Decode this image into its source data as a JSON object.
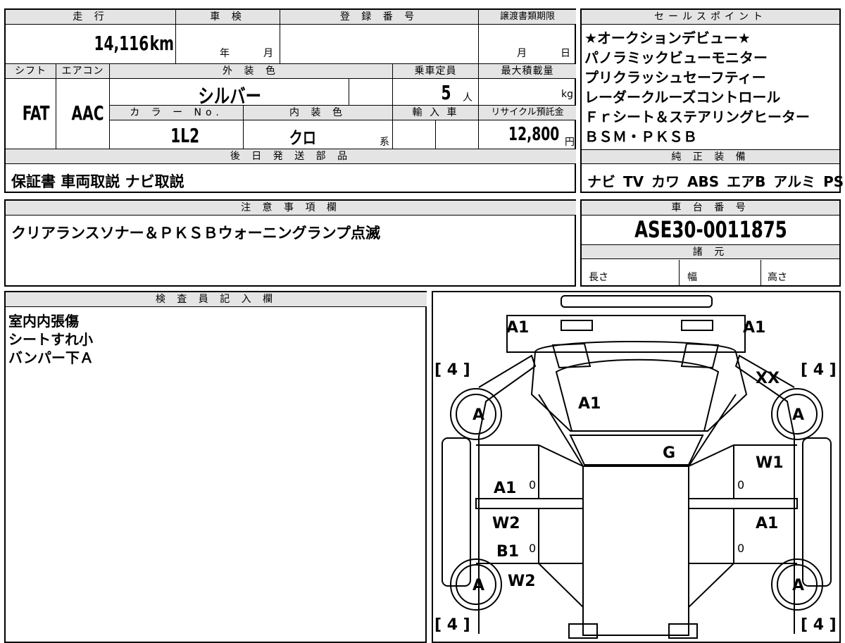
{
  "headers": {
    "mileage": "走 行",
    "inspection": "車 検",
    "registration": "登 録 番 号",
    "transfer_deadline": "譲渡書類期限",
    "sales_points": "セールスポイント",
    "shift": "シフト",
    "aircon": "エアコン",
    "exterior_color": "外 装 色",
    "capacity": "乗車定員",
    "max_load": "最大積載量",
    "color_no": "カ ラ ー No.",
    "interior_color": "内 装 色",
    "import": "輸 入 車",
    "recycle": "リサイクル預託金",
    "later_parts": "後 日 発 送 部 品",
    "genuine_equipment": "純 正 装 備",
    "notes": "注 意 事 項 欄",
    "chassis": "車 台 番 号",
    "specs": "諸 元",
    "inspector": "検 査 員 記 入 欄"
  },
  "vehicle": {
    "mileage_value": "14,116",
    "mileage_unit": "km",
    "inspection_year": "年",
    "inspection_month": "月",
    "deadline_month": "月",
    "deadline_day": "日",
    "shift": "FAT",
    "aircon": "AAC",
    "exterior_color": "シルバー",
    "capacity_value": "5",
    "capacity_unit": "人",
    "load_unit": "kg",
    "color_no": "1L2",
    "interior_color": "クロ",
    "interior_suffix": "系",
    "recycle_value": "12,800",
    "recycle_unit": "円",
    "later_parts": "保証書 車両取説 ナビ取説",
    "genuine_equipment": "ナビ TV カワ ABS エアB アルミ PS PW",
    "notes": "クリアランスソナー＆ＰＫＳＢウォーニングランプ点滅",
    "chassis_number": "ASE30-0011875",
    "spec_length": "長さ",
    "spec_width": "幅",
    "spec_height": "高さ"
  },
  "sales_points": [
    "★オークションデビュー★",
    "パノラミックビューモニター",
    "プリクラッシュセーフティー",
    "レーダークルーズコントロール",
    "Ｆｒシート＆ステアリングヒーター",
    "ＢＳＭ・ＰＫＳＢ"
  ],
  "inspector_notes": [
    "室内内張傷",
    "シートすれ小",
    "バンパー下Ａ"
  ],
  "diagram": {
    "front_left": "A1",
    "front_right": "A1",
    "tire_fl": "[ 4 ]",
    "tire_fr": "[ 4 ]",
    "tire_rl": "[ 4 ]",
    "tire_rr": "[ 4 ]",
    "fr_fender": "XX",
    "wheel_fl": "A",
    "wheel_fr": "A",
    "wheel_rl": "A",
    "wheel_rr": "A",
    "hood": "A1",
    "windshield": "G",
    "door_fr": "W1",
    "door_fl": "A1",
    "door_rl_1": "W2",
    "door_rl_2": "B1",
    "door_rr": "A1",
    "rear_fender_l": "W2",
    "zero": "0"
  }
}
